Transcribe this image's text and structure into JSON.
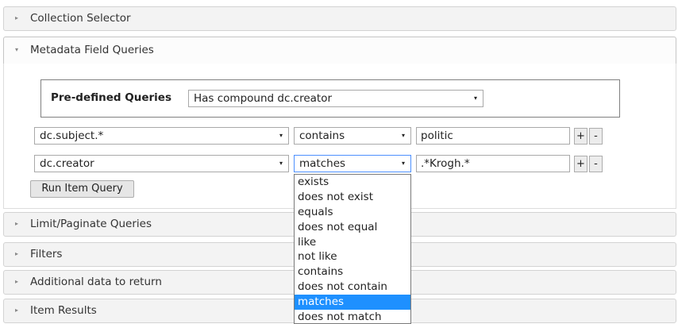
{
  "sections": [
    {
      "label": "Collection Selector",
      "arrow": "▸"
    },
    {
      "label": "Metadata Field Queries",
      "arrow": "▾"
    },
    {
      "label": "Limit/Paginate Queries",
      "arrow": "▸"
    },
    {
      "label": "Filters",
      "arrow": "▸"
    },
    {
      "label": "Additional data to return",
      "arrow": "▸"
    },
    {
      "label": "Item Results",
      "arrow": "▸"
    }
  ],
  "predefined": {
    "label": "Pre-defined Queries",
    "selected": "Has compound dc.creator"
  },
  "rows": [
    {
      "field": "dc.subject.*",
      "operator": "contains",
      "value": "politic"
    },
    {
      "field": "dc.creator",
      "operator": "matches",
      "value": ".*Krogh.*"
    }
  ],
  "buttons": {
    "plus": "+",
    "minus": "-",
    "run": "Run Item Query"
  },
  "caret": "▾",
  "dropdown_options": [
    "exists",
    "does not exist",
    "equals",
    "does not equal",
    "like",
    "not like",
    "contains",
    "does not contain",
    "matches",
    "does not match"
  ],
  "dropdown_selected": "matches",
  "colors": {
    "selected_option": "#1e90ff",
    "focus_border": "#4d90fe"
  }
}
